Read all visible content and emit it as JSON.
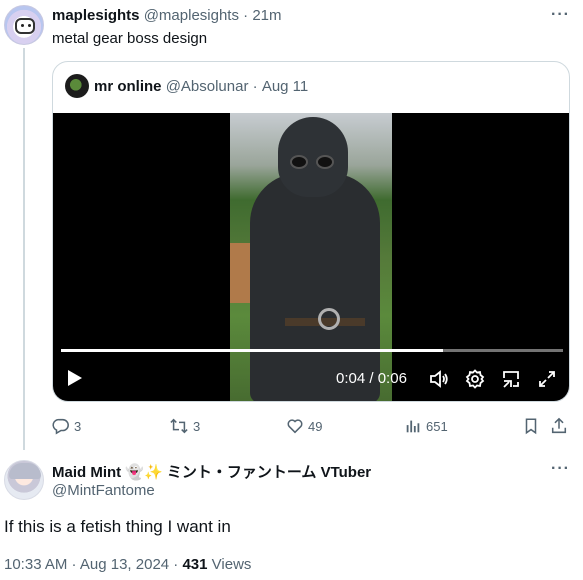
{
  "tweet": {
    "author_name": "maplesights",
    "author_handle": "@maplesights",
    "separator": "·",
    "time": "21m",
    "text": "metal gear boss design",
    "more_icon": "more-horizontal-icon"
  },
  "quote": {
    "author_name": "mr online",
    "author_handle": "@Absolunar",
    "separator": "·",
    "date": "Aug 11",
    "video": {
      "current_time": "0:04",
      "time_separator": "/",
      "duration": "0:06",
      "progress_fraction": 0.76
    }
  },
  "actions": {
    "replies": "3",
    "reposts": "3",
    "likes": "49",
    "views": "651"
  },
  "reply": {
    "author_name": "Maid Mint",
    "author_name_suffix": "ミント・ファントーム VTuber",
    "emoji": "👻✨",
    "author_handle": "@MintFantome",
    "text": "If this is a fetish thing I want in",
    "timestamp": "10:33 AM · Aug 13, 2024 ·",
    "views_count": "431",
    "views_label": "Views"
  },
  "colors": {
    "text": "#0f1419",
    "muted": "#536471",
    "border": "#cfd9de"
  }
}
